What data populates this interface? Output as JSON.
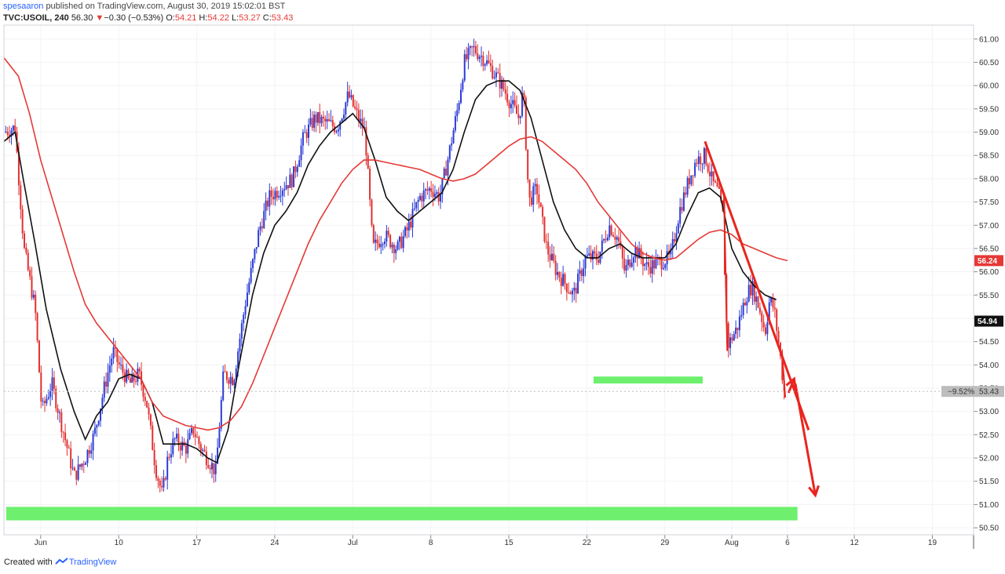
{
  "header": {
    "author": "spesaaron",
    "published_text": "published on TradingView.com, August 30, 2019 15:02:01 BST",
    "symbol": "TVC:USOIL, 240",
    "last": "56.30",
    "change_arrow": "▼",
    "change": "−0.30 (−0.53%)",
    "o_label": "O:",
    "o_value": "54.21",
    "h_label": "H:",
    "h_value": "54.22",
    "l_label": "L:",
    "l_value": "53.27",
    "c_label": "C:",
    "c_value": "53.43"
  },
  "footer": {
    "created_with": "Created with",
    "brand": "TradingView"
  },
  "colors": {
    "up": "#2b3bd6",
    "down": "#e23030",
    "ma_fast": "#111111",
    "ma_slow": "#e53935",
    "annotation": "#e8251e",
    "zone": "#6ef06e",
    "axis_text": "#333333"
  },
  "chart_data": {
    "type": "candlestick",
    "title": "",
    "xlabel": "",
    "ylabel": "",
    "ylim": [
      50.35,
      61.3
    ],
    "y_ticks": [
      "61.00",
      "60.50",
      "60.00",
      "59.50",
      "59.00",
      "58.50",
      "58.00",
      "57.50",
      "57.00",
      "56.50",
      "56.00",
      "55.50",
      "55.00",
      "54.50",
      "54.00",
      "53.50",
      "53.00",
      "52.50",
      "52.00",
      "51.50",
      "51.00",
      "50.50"
    ],
    "x_ticks": [
      {
        "label": "Jun",
        "day": 3
      },
      {
        "label": "10",
        "day": 10
      },
      {
        "label": "17",
        "day": 17
      },
      {
        "label": "24",
        "day": 24
      },
      {
        "label": "Jul",
        "day": 31
      },
      {
        "label": "8",
        "day": 38
      },
      {
        "label": "15",
        "day": 45
      },
      {
        "label": "22",
        "day": 52
      },
      {
        "label": "29",
        "day": 59
      },
      {
        "label": "Aug",
        "day": 65
      },
      {
        "label": "6",
        "day": 70
      },
      {
        "label": "12",
        "day": 76
      },
      {
        "label": "19",
        "day": 83
      }
    ],
    "x_range_days": [
      -0.3,
      86.7
    ],
    "close_path": [
      {
        "d": -0.3,
        "p": 59.0
      },
      {
        "d": 0.7,
        "p": 59.1
      },
      {
        "d": 1.5,
        "p": 56.5
      },
      {
        "d": 2.5,
        "p": 55.2
      },
      {
        "d": 3.1,
        "p": 53.0
      },
      {
        "d": 4.0,
        "p": 53.6
      },
      {
        "d": 5.0,
        "p": 52.6
      },
      {
        "d": 6.0,
        "p": 51.6
      },
      {
        "d": 7.0,
        "p": 52.0
      },
      {
        "d": 7.8,
        "p": 52.5
      },
      {
        "d": 8.7,
        "p": 53.5
      },
      {
        "d": 9.5,
        "p": 54.3
      },
      {
        "d": 10.0,
        "p": 54.0
      },
      {
        "d": 11.0,
        "p": 53.6
      },
      {
        "d": 11.8,
        "p": 53.8
      },
      {
        "d": 12.5,
        "p": 53.2
      },
      {
        "d": 13.3,
        "p": 51.8
      },
      {
        "d": 13.9,
        "p": 51.2
      },
      {
        "d": 14.4,
        "p": 52.0
      },
      {
        "d": 15.0,
        "p": 52.4
      },
      {
        "d": 16.0,
        "p": 52.2
      },
      {
        "d": 16.7,
        "p": 52.6
      },
      {
        "d": 17.4,
        "p": 52.2
      },
      {
        "d": 18.2,
        "p": 51.9
      },
      {
        "d": 18.7,
        "p": 51.7
      },
      {
        "d": 19.4,
        "p": 53.8
      },
      {
        "d": 20.3,
        "p": 53.7
      },
      {
        "d": 21.4,
        "p": 55.4
      },
      {
        "d": 22.6,
        "p": 56.9
      },
      {
        "d": 23.5,
        "p": 57.6
      },
      {
        "d": 24.5,
        "p": 57.8
      },
      {
        "d": 25.6,
        "p": 58.0
      },
      {
        "d": 26.6,
        "p": 58.9
      },
      {
        "d": 27.6,
        "p": 59.3
      },
      {
        "d": 28.6,
        "p": 59.2
      },
      {
        "d": 29.6,
        "p": 59.1
      },
      {
        "d": 30.6,
        "p": 59.8
      },
      {
        "d": 31.5,
        "p": 59.3
      },
      {
        "d": 32.1,
        "p": 59.0
      },
      {
        "d": 32.8,
        "p": 56.5
      },
      {
        "d": 33.8,
        "p": 56.8
      },
      {
        "d": 35.0,
        "p": 56.5
      },
      {
        "d": 35.9,
        "p": 56.9
      },
      {
        "d": 37.0,
        "p": 57.6
      },
      {
        "d": 38.0,
        "p": 57.8
      },
      {
        "d": 38.8,
        "p": 57.6
      },
      {
        "d": 39.6,
        "p": 58.5
      },
      {
        "d": 40.4,
        "p": 59.5
      },
      {
        "d": 41.0,
        "p": 60.5
      },
      {
        "d": 41.8,
        "p": 60.8
      },
      {
        "d": 42.7,
        "p": 60.6
      },
      {
        "d": 43.6,
        "p": 60.3
      },
      {
        "d": 44.4,
        "p": 60.0
      },
      {
        "d": 45.0,
        "p": 59.7
      },
      {
        "d": 45.9,
        "p": 59.3
      },
      {
        "d": 46.3,
        "p": 59.9
      },
      {
        "d": 46.8,
        "p": 57.5
      },
      {
        "d": 47.5,
        "p": 57.8
      },
      {
        "d": 48.4,
        "p": 56.5
      },
      {
        "d": 49.3,
        "p": 56.0
      },
      {
        "d": 50.2,
        "p": 55.7
      },
      {
        "d": 50.8,
        "p": 55.5
      },
      {
        "d": 51.9,
        "p": 56.3
      },
      {
        "d": 53.0,
        "p": 56.3
      },
      {
        "d": 54.0,
        "p": 57.0
      },
      {
        "d": 54.8,
        "p": 56.7
      },
      {
        "d": 55.4,
        "p": 56.0
      },
      {
        "d": 56.3,
        "p": 56.5
      },
      {
        "d": 57.4,
        "p": 56.1
      },
      {
        "d": 58.4,
        "p": 56.2
      },
      {
        "d": 59.5,
        "p": 56.3
      },
      {
        "d": 60.3,
        "p": 57.3
      },
      {
        "d": 61.2,
        "p": 58.0
      },
      {
        "d": 61.8,
        "p": 58.4
      },
      {
        "d": 62.6,
        "p": 58.5
      },
      {
        "d": 63.3,
        "p": 57.9
      },
      {
        "d": 63.8,
        "p": 57.7
      },
      {
        "d": 64.2,
        "p": 57.2
      },
      {
        "d": 64.6,
        "p": 54.4
      },
      {
        "d": 65.5,
        "p": 54.8
      },
      {
        "d": 66.3,
        "p": 55.5
      },
      {
        "d": 66.8,
        "p": 55.7
      },
      {
        "d": 67.5,
        "p": 55.2
      },
      {
        "d": 68.0,
        "p": 54.7
      },
      {
        "d": 68.4,
        "p": 55.4
      },
      {
        "d": 68.8,
        "p": 55.2
      },
      {
        "d": 69.3,
        "p": 54.3
      },
      {
        "d": 69.7,
        "p": 53.43
      }
    ],
    "series": [
      {
        "key": "ma_fast",
        "points": [
          {
            "d": -0.3,
            "p": 58.8
          },
          {
            "d": 0.7,
            "p": 59.0
          },
          {
            "d": 1.5,
            "p": 57.9
          },
          {
            "d": 2.5,
            "p": 56.6
          },
          {
            "d": 3.5,
            "p": 55.2
          },
          {
            "d": 4.8,
            "p": 53.9
          },
          {
            "d": 6.0,
            "p": 53.0
          },
          {
            "d": 7.0,
            "p": 52.4
          },
          {
            "d": 8.0,
            "p": 52.9
          },
          {
            "d": 9.0,
            "p": 53.2
          },
          {
            "d": 10.0,
            "p": 53.7
          },
          {
            "d": 11.0,
            "p": 53.8
          },
          {
            "d": 12.0,
            "p": 53.7
          },
          {
            "d": 13.0,
            "p": 53.2
          },
          {
            "d": 14.0,
            "p": 52.3
          },
          {
            "d": 15.0,
            "p": 52.3
          },
          {
            "d": 16.0,
            "p": 52.3
          },
          {
            "d": 17.0,
            "p": 52.2
          },
          {
            "d": 18.0,
            "p": 52.0
          },
          {
            "d": 18.8,
            "p": 51.9
          },
          {
            "d": 19.8,
            "p": 52.6
          },
          {
            "d": 20.8,
            "p": 54.0
          },
          {
            "d": 22.0,
            "p": 55.5
          },
          {
            "d": 23.0,
            "p": 56.4
          },
          {
            "d": 24.0,
            "p": 57.0
          },
          {
            "d": 25.0,
            "p": 57.3
          },
          {
            "d": 26.0,
            "p": 57.7
          },
          {
            "d": 27.0,
            "p": 58.3
          },
          {
            "d": 28.0,
            "p": 58.7
          },
          {
            "d": 29.0,
            "p": 59.0
          },
          {
            "d": 30.0,
            "p": 59.2
          },
          {
            "d": 31.0,
            "p": 59.4
          },
          {
            "d": 32.0,
            "p": 59.1
          },
          {
            "d": 33.0,
            "p": 58.4
          },
          {
            "d": 34.0,
            "p": 57.6
          },
          {
            "d": 35.0,
            "p": 57.3
          },
          {
            "d": 36.0,
            "p": 57.1
          },
          {
            "d": 37.0,
            "p": 57.3
          },
          {
            "d": 38.0,
            "p": 57.5
          },
          {
            "d": 39.0,
            "p": 57.7
          },
          {
            "d": 40.0,
            "p": 58.2
          },
          {
            "d": 41.0,
            "p": 59.0
          },
          {
            "d": 42.0,
            "p": 59.7
          },
          {
            "d": 43.0,
            "p": 60.0
          },
          {
            "d": 44.0,
            "p": 60.1
          },
          {
            "d": 45.0,
            "p": 60.1
          },
          {
            "d": 46.0,
            "p": 59.9
          },
          {
            "d": 47.0,
            "p": 59.3
          },
          {
            "d": 48.0,
            "p": 58.4
          },
          {
            "d": 49.0,
            "p": 57.5
          },
          {
            "d": 50.0,
            "p": 56.9
          },
          {
            "d": 51.0,
            "p": 56.5
          },
          {
            "d": 52.0,
            "p": 56.3
          },
          {
            "d": 53.0,
            "p": 56.3
          },
          {
            "d": 54.0,
            "p": 56.5
          },
          {
            "d": 55.0,
            "p": 56.6
          },
          {
            "d": 56.0,
            "p": 56.4
          },
          {
            "d": 57.0,
            "p": 56.3
          },
          {
            "d": 58.0,
            "p": 56.3
          },
          {
            "d": 59.0,
            "p": 56.3
          },
          {
            "d": 60.0,
            "p": 56.6
          },
          {
            "d": 61.0,
            "p": 57.2
          },
          {
            "d": 62.0,
            "p": 57.7
          },
          {
            "d": 63.0,
            "p": 57.8
          },
          {
            "d": 64.0,
            "p": 57.6
          },
          {
            "d": 65.0,
            "p": 56.5
          },
          {
            "d": 66.0,
            "p": 56.0
          },
          {
            "d": 67.0,
            "p": 55.7
          },
          {
            "d": 68.0,
            "p": 55.5
          },
          {
            "d": 69.0,
            "p": 55.4
          }
        ]
      },
      {
        "key": "ma_slow",
        "points": [
          {
            "d": -0.3,
            "p": 60.6
          },
          {
            "d": 1.0,
            "p": 60.2
          },
          {
            "d": 2.0,
            "p": 59.4
          },
          {
            "d": 3.0,
            "p": 58.4
          },
          {
            "d": 4.0,
            "p": 57.6
          },
          {
            "d": 5.0,
            "p": 56.8
          },
          {
            "d": 6.0,
            "p": 56.0
          },
          {
            "d": 7.0,
            "p": 55.3
          },
          {
            "d": 8.0,
            "p": 54.9
          },
          {
            "d": 9.0,
            "p": 54.6
          },
          {
            "d": 10.0,
            "p": 54.3
          },
          {
            "d": 11.0,
            "p": 54.0
          },
          {
            "d": 12.0,
            "p": 53.7
          },
          {
            "d": 13.0,
            "p": 53.2
          },
          {
            "d": 14.0,
            "p": 52.9
          },
          {
            "d": 15.0,
            "p": 52.8
          },
          {
            "d": 16.0,
            "p": 52.7
          },
          {
            "d": 17.0,
            "p": 52.65
          },
          {
            "d": 18.0,
            "p": 52.6
          },
          {
            "d": 19.0,
            "p": 52.65
          },
          {
            "d": 20.0,
            "p": 52.8
          },
          {
            "d": 21.0,
            "p": 53.1
          },
          {
            "d": 22.0,
            "p": 53.6
          },
          {
            "d": 23.0,
            "p": 54.2
          },
          {
            "d": 24.0,
            "p": 54.8
          },
          {
            "d": 25.0,
            "p": 55.4
          },
          {
            "d": 26.0,
            "p": 56.0
          },
          {
            "d": 27.0,
            "p": 56.6
          },
          {
            "d": 28.0,
            "p": 57.1
          },
          {
            "d": 29.0,
            "p": 57.5
          },
          {
            "d": 30.0,
            "p": 57.9
          },
          {
            "d": 31.0,
            "p": 58.2
          },
          {
            "d": 32.0,
            "p": 58.4
          },
          {
            "d": 33.0,
            "p": 58.4
          },
          {
            "d": 34.0,
            "p": 58.35
          },
          {
            "d": 35.0,
            "p": 58.3
          },
          {
            "d": 36.0,
            "p": 58.25
          },
          {
            "d": 37.0,
            "p": 58.2
          },
          {
            "d": 38.0,
            "p": 58.1
          },
          {
            "d": 39.0,
            "p": 58.0
          },
          {
            "d": 40.0,
            "p": 57.95
          },
          {
            "d": 41.0,
            "p": 58.0
          },
          {
            "d": 42.0,
            "p": 58.1
          },
          {
            "d": 43.0,
            "p": 58.3
          },
          {
            "d": 44.0,
            "p": 58.5
          },
          {
            "d": 45.0,
            "p": 58.7
          },
          {
            "d": 46.0,
            "p": 58.85
          },
          {
            "d": 47.0,
            "p": 58.9
          },
          {
            "d": 48.0,
            "p": 58.8
          },
          {
            "d": 49.0,
            "p": 58.6
          },
          {
            "d": 50.0,
            "p": 58.4
          },
          {
            "d": 51.0,
            "p": 58.2
          },
          {
            "d": 52.0,
            "p": 57.9
          },
          {
            "d": 53.0,
            "p": 57.5
          },
          {
            "d": 54.0,
            "p": 57.2
          },
          {
            "d": 55.0,
            "p": 56.9
          },
          {
            "d": 56.0,
            "p": 56.6
          },
          {
            "d": 57.0,
            "p": 56.4
          },
          {
            "d": 58.0,
            "p": 56.3
          },
          {
            "d": 59.0,
            "p": 56.25
          },
          {
            "d": 60.0,
            "p": 56.3
          },
          {
            "d": 61.0,
            "p": 56.5
          },
          {
            "d": 62.0,
            "p": 56.7
          },
          {
            "d": 63.0,
            "p": 56.85
          },
          {
            "d": 64.0,
            "p": 56.9
          },
          {
            "d": 65.0,
            "p": 56.8
          },
          {
            "d": 66.0,
            "p": 56.6
          },
          {
            "d": 67.0,
            "p": 56.5
          },
          {
            "d": 68.0,
            "p": 56.4
          },
          {
            "d": 69.0,
            "p": 56.3
          },
          {
            "d": 70.0,
            "p": 56.24
          }
        ]
      }
    ],
    "support_zones": [
      {
        "d_from": -0.1,
        "d_to": 70.9,
        "p_low": 50.66,
        "p_high": 50.95
      },
      {
        "d_from": 52.6,
        "d_to": 62.4,
        "p_low": 53.6,
        "p_high": 53.75
      }
    ],
    "trend_lines": [
      {
        "d1": 62.6,
        "p1": 58.8,
        "d2": 71.9,
        "p2": 52.6
      },
      {
        "d1": 64.3,
        "p1": 57.7,
        "d2": 64.6,
        "p2": 54.3
      },
      {
        "d1": 69.5,
        "p1": 54.3,
        "d2": 69.8,
        "p2": 53.3
      }
    ],
    "arrows": [
      {
        "d1": 70.1,
        "p1": 53.4,
        "d2": 70.6,
        "p2": 53.7
      },
      {
        "d1": 70.7,
        "p1": 53.6,
        "d2": 72.5,
        "p2": 51.2
      }
    ],
    "price_labels": [
      {
        "text": "56.24",
        "price": 56.24,
        "style": "red"
      },
      {
        "text": "54.94",
        "price": 54.94,
        "style": "black"
      },
      {
        "pct": "−9.52%",
        "text": "53.43",
        "price": 53.43,
        "style": "gray"
      }
    ]
  }
}
